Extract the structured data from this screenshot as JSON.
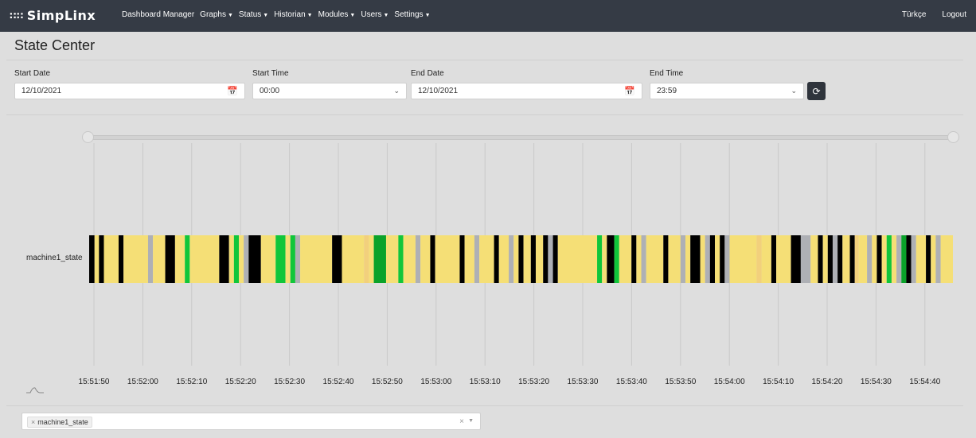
{
  "nav": {
    "brand": "SimpLinx",
    "items": [
      {
        "label": "Dashboard Manager",
        "caret": false
      },
      {
        "label": "Graphs",
        "caret": true
      },
      {
        "label": "Status",
        "caret": true
      },
      {
        "label": "Historian",
        "caret": true
      },
      {
        "label": "Modules",
        "caret": true
      },
      {
        "label": "Users",
        "caret": true
      },
      {
        "label": "Settings",
        "caret": true
      }
    ],
    "language": "Türkçe",
    "logout": "Logout"
  },
  "page": {
    "title": "State Center"
  },
  "filters": {
    "start_date_label": "Start Date",
    "start_date_value": "12/10/2021",
    "start_time_label": "Start Time",
    "start_time_value": "00:00",
    "end_date_label": "End Date",
    "end_date_value": "12/10/2021",
    "end_time_label": "End Time",
    "end_time_value": "23:59"
  },
  "series_select": {
    "selected": [
      "machine1_state"
    ]
  },
  "colors": {
    "yellow": "#f5df76",
    "light_yellow": "#f3de80",
    "orange": "#f2d07c",
    "black": "#000000",
    "green": "#10c63a",
    "dark_green": "#0aa22a",
    "gray": "#aeb0b5"
  },
  "chart_data": {
    "type": "timeline",
    "series": [
      {
        "name": "machine1_state",
        "segments": [
          {
            "start": 0.0,
            "end": 1.1,
            "state": "black"
          },
          {
            "start": 1.1,
            "end": 2.0,
            "state": "yellow"
          },
          {
            "start": 2.0,
            "end": 3.0,
            "state": "black"
          },
          {
            "start": 3.0,
            "end": 6.0,
            "state": "yellow"
          },
          {
            "start": 6.0,
            "end": 7.0,
            "state": "black"
          },
          {
            "start": 7.0,
            "end": 12.0,
            "state": "yellow"
          },
          {
            "start": 12.0,
            "end": 13.0,
            "state": "gray"
          },
          {
            "start": 13.0,
            "end": 15.5,
            "state": "yellow"
          },
          {
            "start": 15.5,
            "end": 17.5,
            "state": "black"
          },
          {
            "start": 17.5,
            "end": 19.5,
            "state": "yellow"
          },
          {
            "start": 19.5,
            "end": 20.5,
            "state": "green"
          },
          {
            "start": 20.5,
            "end": 26.5,
            "state": "yellow"
          },
          {
            "start": 26.5,
            "end": 28.5,
            "state": "black"
          },
          {
            "start": 28.5,
            "end": 29.5,
            "state": "yellow"
          },
          {
            "start": 29.5,
            "end": 30.5,
            "state": "green"
          },
          {
            "start": 30.5,
            "end": 31.5,
            "state": "yellow"
          },
          {
            "start": 31.5,
            "end": 32.5,
            "state": "gray"
          },
          {
            "start": 32.5,
            "end": 35.0,
            "state": "black"
          },
          {
            "start": 35.0,
            "end": 38.0,
            "state": "yellow"
          },
          {
            "start": 38.0,
            "end": 40.0,
            "state": "green"
          },
          {
            "start": 40.0,
            "end": 41.0,
            "state": "yellow"
          },
          {
            "start": 41.0,
            "end": 42.0,
            "state": "green"
          },
          {
            "start": 42.0,
            "end": 43.0,
            "state": "gray"
          },
          {
            "start": 43.0,
            "end": 49.5,
            "state": "yellow"
          },
          {
            "start": 49.5,
            "end": 51.5,
            "state": "black"
          },
          {
            "start": 51.5,
            "end": 56.0,
            "state": "yellow"
          },
          {
            "start": 56.0,
            "end": 57.0,
            "state": "orange"
          },
          {
            "start": 57.0,
            "end": 58.0,
            "state": "yellow"
          },
          {
            "start": 58.0,
            "end": 60.5,
            "state": "dark_green"
          },
          {
            "start": 60.5,
            "end": 63.0,
            "state": "yellow"
          },
          {
            "start": 63.0,
            "end": 64.0,
            "state": "green"
          },
          {
            "start": 64.0,
            "end": 66.5,
            "state": "yellow"
          },
          {
            "start": 66.5,
            "end": 67.5,
            "state": "gray"
          },
          {
            "start": 67.5,
            "end": 69.5,
            "state": "yellow"
          },
          {
            "start": 69.5,
            "end": 70.5,
            "state": "black"
          },
          {
            "start": 70.5,
            "end": 75.5,
            "state": "yellow"
          },
          {
            "start": 75.5,
            "end": 76.5,
            "state": "black"
          },
          {
            "start": 76.5,
            "end": 78.5,
            "state": "yellow"
          },
          {
            "start": 78.5,
            "end": 79.5,
            "state": "gray"
          },
          {
            "start": 79.5,
            "end": 82.5,
            "state": "yellow"
          },
          {
            "start": 82.5,
            "end": 83.5,
            "state": "black"
          },
          {
            "start": 83.5,
            "end": 85.5,
            "state": "yellow"
          },
          {
            "start": 85.5,
            "end": 86.5,
            "state": "gray"
          },
          {
            "start": 86.5,
            "end": 87.5,
            "state": "yellow"
          },
          {
            "start": 87.5,
            "end": 88.5,
            "state": "black"
          },
          {
            "start": 88.5,
            "end": 90.0,
            "state": "yellow"
          },
          {
            "start": 90.0,
            "end": 91.0,
            "state": "black"
          },
          {
            "start": 91.0,
            "end": 92.5,
            "state": "yellow"
          },
          {
            "start": 92.5,
            "end": 93.5,
            "state": "black"
          },
          {
            "start": 93.5,
            "end": 94.5,
            "state": "gray"
          },
          {
            "start": 94.5,
            "end": 95.5,
            "state": "black"
          },
          {
            "start": 95.5,
            "end": 103.5,
            "state": "yellow"
          },
          {
            "start": 103.5,
            "end": 104.5,
            "state": "green"
          },
          {
            "start": 104.5,
            "end": 105.5,
            "state": "yellow"
          },
          {
            "start": 105.5,
            "end": 107.0,
            "state": "black"
          },
          {
            "start": 107.0,
            "end": 108.0,
            "state": "green"
          },
          {
            "start": 108.0,
            "end": 110.5,
            "state": "yellow"
          },
          {
            "start": 110.5,
            "end": 111.5,
            "state": "black"
          },
          {
            "start": 111.5,
            "end": 112.5,
            "state": "yellow"
          },
          {
            "start": 112.5,
            "end": 113.5,
            "state": "gray"
          },
          {
            "start": 113.5,
            "end": 117.0,
            "state": "yellow"
          },
          {
            "start": 117.0,
            "end": 118.0,
            "state": "black"
          },
          {
            "start": 118.0,
            "end": 120.5,
            "state": "yellow"
          },
          {
            "start": 120.5,
            "end": 121.5,
            "state": "gray"
          },
          {
            "start": 121.5,
            "end": 122.5,
            "state": "yellow"
          },
          {
            "start": 122.5,
            "end": 124.5,
            "state": "black"
          },
          {
            "start": 124.5,
            "end": 125.5,
            "state": "yellow"
          },
          {
            "start": 125.5,
            "end": 126.5,
            "state": "gray"
          },
          {
            "start": 126.5,
            "end": 127.5,
            "state": "black"
          },
          {
            "start": 127.5,
            "end": 128.5,
            "state": "yellow"
          },
          {
            "start": 128.5,
            "end": 129.5,
            "state": "black"
          },
          {
            "start": 129.5,
            "end": 130.5,
            "state": "gray"
          },
          {
            "start": 130.5,
            "end": 136.0,
            "state": "yellow"
          },
          {
            "start": 136.0,
            "end": 137.0,
            "state": "orange"
          },
          {
            "start": 137.0,
            "end": 139.0,
            "state": "yellow"
          },
          {
            "start": 139.0,
            "end": 140.0,
            "state": "black"
          },
          {
            "start": 140.0,
            "end": 143.0,
            "state": "yellow"
          },
          {
            "start": 143.0,
            "end": 145.0,
            "state": "black"
          },
          {
            "start": 145.0,
            "end": 147.0,
            "state": "gray"
          },
          {
            "start": 147.0,
            "end": 148.5,
            "state": "yellow"
          },
          {
            "start": 148.5,
            "end": 149.5,
            "state": "black"
          },
          {
            "start": 149.5,
            "end": 150.5,
            "state": "yellow"
          },
          {
            "start": 150.5,
            "end": 151.5,
            "state": "black"
          },
          {
            "start": 151.5,
            "end": 152.5,
            "state": "gray"
          },
          {
            "start": 152.5,
            "end": 153.5,
            "state": "black"
          },
          {
            "start": 153.5,
            "end": 155.0,
            "state": "yellow"
          },
          {
            "start": 155.0,
            "end": 156.0,
            "state": "black"
          },
          {
            "start": 156.0,
            "end": 156.8,
            "state": "orange"
          },
          {
            "start": 156.8,
            "end": 158.5,
            "state": "yellow"
          },
          {
            "start": 158.5,
            "end": 159.5,
            "state": "gray"
          },
          {
            "start": 159.5,
            "end": 160.5,
            "state": "yellow"
          },
          {
            "start": 160.5,
            "end": 161.5,
            "state": "black"
          },
          {
            "start": 161.5,
            "end": 162.5,
            "state": "yellow"
          },
          {
            "start": 162.5,
            "end": 163.5,
            "state": "green"
          },
          {
            "start": 163.5,
            "end": 164.5,
            "state": "yellow"
          },
          {
            "start": 164.5,
            "end": 165.5,
            "state": "gray"
          },
          {
            "start": 165.5,
            "end": 166.5,
            "state": "dark_green"
          },
          {
            "start": 166.5,
            "end": 167.5,
            "state": "black"
          },
          {
            "start": 167.5,
            "end": 168.5,
            "state": "gray"
          },
          {
            "start": 168.5,
            "end": 170.5,
            "state": "yellow"
          },
          {
            "start": 170.5,
            "end": 171.5,
            "state": "black"
          },
          {
            "start": 171.5,
            "end": 172.5,
            "state": "yellow"
          },
          {
            "start": 172.5,
            "end": 173.5,
            "state": "gray"
          },
          {
            "start": 173.5,
            "end": 176.0,
            "state": "yellow"
          }
        ]
      }
    ],
    "x_range": [
      0,
      176
    ],
    "x_ticks": [
      {
        "t": 0,
        "label": "15:51:50"
      },
      {
        "t": 10,
        "label": "15:52:00"
      },
      {
        "t": 20,
        "label": "15:52:10"
      },
      {
        "t": 30,
        "label": "15:52:20"
      },
      {
        "t": 40,
        "label": "15:52:30"
      },
      {
        "t": 50,
        "label": "15:52:40"
      },
      {
        "t": 60,
        "label": "15:52:50"
      },
      {
        "t": 70,
        "label": "15:53:00"
      },
      {
        "t": 80,
        "label": "15:53:10"
      },
      {
        "t": 90,
        "label": "15:53:20"
      },
      {
        "t": 100,
        "label": "15:53:30"
      },
      {
        "t": 110,
        "label": "15:53:40"
      },
      {
        "t": 120,
        "label": "15:53:50"
      },
      {
        "t": 130,
        "label": "15:54:00"
      },
      {
        "t": 140,
        "label": "15:54:10"
      },
      {
        "t": 150,
        "label": "15:54:20"
      },
      {
        "t": 160,
        "label": "15:54:30"
      },
      {
        "t": 170,
        "label": "15:54:40"
      }
    ],
    "grid": true
  }
}
